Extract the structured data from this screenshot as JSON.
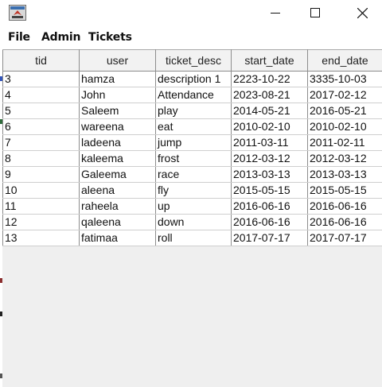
{
  "window": {
    "controls": {
      "minimize": "minimize",
      "maximize": "maximize",
      "close": "close"
    }
  },
  "menu": [
    "File",
    "Admin",
    "Tickets"
  ],
  "table": {
    "columns": [
      "tid",
      "user",
      "ticket_desc",
      "start_date",
      "end_date"
    ],
    "rows": [
      [
        "3",
        "hamza",
        "description 1",
        "2223-10-22",
        "3335-10-03"
      ],
      [
        "4",
        "John",
        "Attendance",
        "2023-08-21",
        "2017-02-12"
      ],
      [
        "5",
        "Saleem",
        "play",
        "2014-05-21",
        "2016-05-21"
      ],
      [
        "6",
        "wareena",
        "eat",
        "2010-02-10",
        "2010-02-10"
      ],
      [
        "7",
        "ladeena",
        "jump",
        "2011-03-11",
        "2011-02-11"
      ],
      [
        "8",
        "kaleema",
        "frost",
        "2012-03-12",
        "2012-03-12"
      ],
      [
        "9",
        "Galeema",
        "race",
        "2013-03-13",
        "2013-03-13"
      ],
      [
        "10",
        "aleena",
        "fly",
        "2015-05-15",
        "2015-05-15"
      ],
      [
        "11",
        "raheela",
        "up",
        "2016-06-16",
        "2016-06-16"
      ],
      [
        "12",
        "qaleena",
        "down",
        "2016-06-16",
        "2016-06-16"
      ],
      [
        "13",
        "fatimaa",
        "roll",
        "2017-07-17",
        "2017-07-17"
      ]
    ]
  }
}
